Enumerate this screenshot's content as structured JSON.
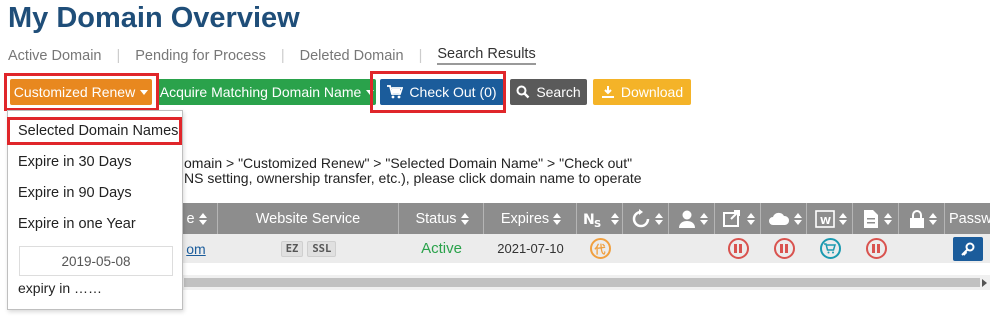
{
  "page": {
    "title": "My Domain Overview"
  },
  "tabs": [
    {
      "label": "Active Domain"
    },
    {
      "label": "Pending for Process"
    },
    {
      "label": "Deleted Domain"
    },
    {
      "label": "Search Results",
      "active": true
    }
  ],
  "toolbar": {
    "renew_label": "Customized Renew",
    "acquire_label": "Acquire Matching Domain Name",
    "checkout_label": "Check Out (0)",
    "search_label": "Search",
    "download_label": "Download"
  },
  "dropdown": {
    "items": [
      "Selected Domain Names",
      "Expire in 30 Days",
      "Expire in 90 Days",
      "Expire in one Year"
    ],
    "date_value": "2019-05-08",
    "note": "expiry in ……"
  },
  "info": {
    "line1": "omain > \"Customized Renew\" > \"Selected Domain Name\" > \"Check out\"",
    "line2": "NS setting, ownership transfer, etc.), please click domain name to operate"
  },
  "table": {
    "headers": {
      "name": "e",
      "website_service": "Website Service",
      "status": "Status",
      "expires": "Expires",
      "password": "Passw"
    },
    "row": {
      "domain": "om",
      "services": [
        "EZ",
        "SSL"
      ],
      "status": "Active",
      "expires": "2021-07-10",
      "proxy_badge": "代"
    }
  },
  "colors": {
    "title": "#1f4e79",
    "renew": "#e8881f",
    "acquire": "#2aa24b",
    "checkout": "#1b5c9b",
    "search": "#5a5a5a",
    "download": "#f4b328",
    "highlight": "#e0262a",
    "header_bg": "#8d8d8d",
    "active_status": "#2aa24b"
  },
  "icons": [
    "cart-icon",
    "search-icon",
    "download-icon",
    "ns-icon",
    "refresh-icon",
    "user-icon",
    "transfer-icon",
    "cloud-icon",
    "website-icon",
    "document-icon",
    "lock-icon",
    "pause-icon",
    "key-icon"
  ]
}
